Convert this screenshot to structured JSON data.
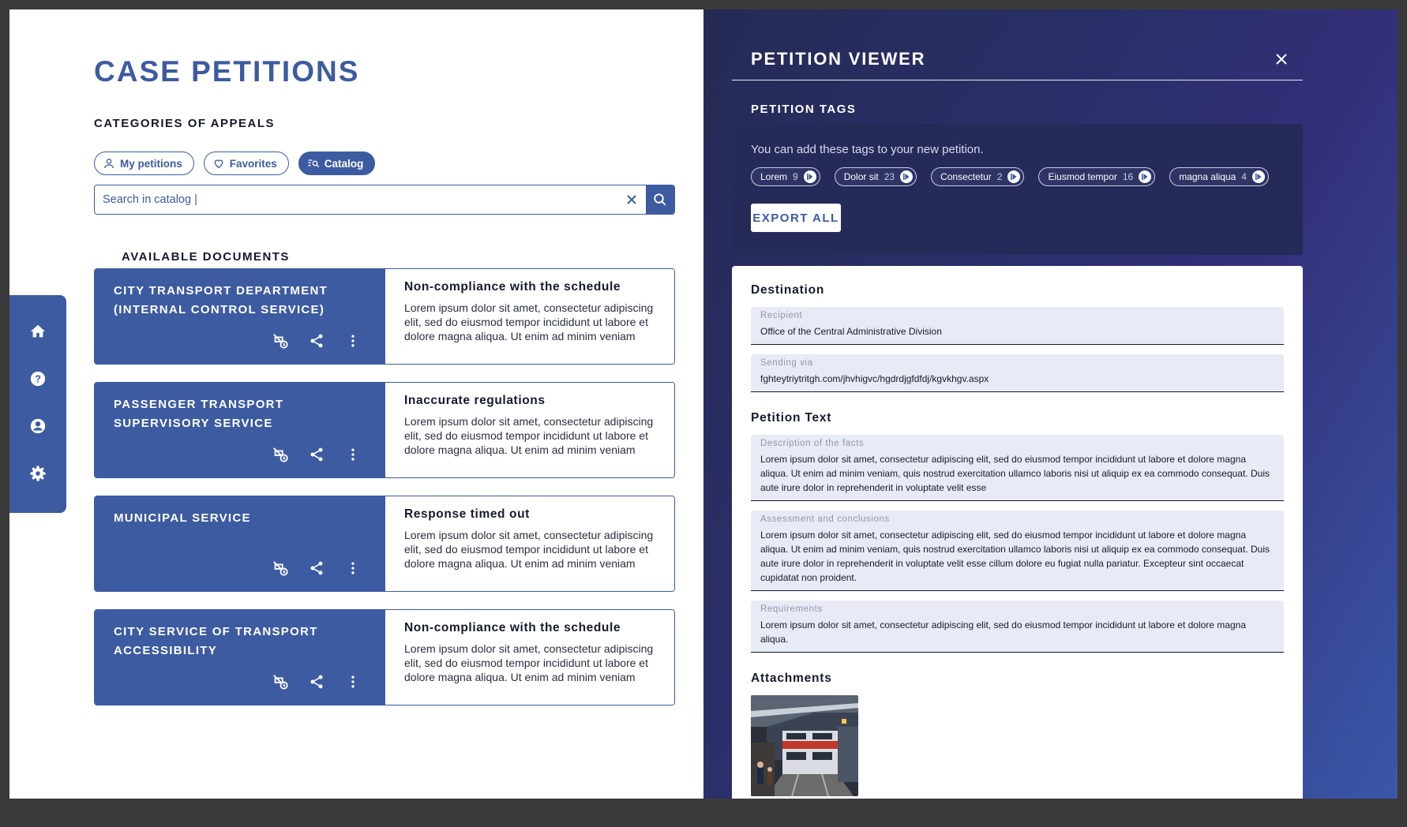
{
  "page_title": "CASE PETITIONS",
  "categories_title": "CATEGORIES OF APPEALS",
  "tabs": [
    {
      "label": "My petitions",
      "icon": "person-icon",
      "active": false
    },
    {
      "label": "Favorites",
      "icon": "heart-icon",
      "active": false
    },
    {
      "label": "Catalog",
      "icon": "catalog-search-icon",
      "active": true
    }
  ],
  "search": {
    "value": "Search in catalog |"
  },
  "side_nav": [
    {
      "icon": "home-icon"
    },
    {
      "icon": "help-icon"
    },
    {
      "icon": "account-icon"
    },
    {
      "icon": "settings-icon"
    }
  ],
  "documents_title": "AVAILABLE DOCUMENTS",
  "documents": [
    {
      "department": "CITY TRANSPORT DEPARTMENT (INTERNAL CONTROL SERVICE)",
      "title": "Non-compliance with the schedule",
      "text": "Lorem ipsum dolor sit amet, consectetur adipiscing elit, sed do eiusmod tempor incididunt ut labore et dolore magna aliqua. Ut enim ad minim veniam"
    },
    {
      "department": "PASSENGER TRANSPORT SUPERVISORY SERVICE",
      "title": "Inaccurate regulations",
      "text": "Lorem ipsum dolor sit amet, consectetur adipiscing elit, sed do eiusmod tempor incididunt ut labore et dolore magna aliqua. Ut enim ad minim veniam"
    },
    {
      "department": "MUNICIPAL SERVICE",
      "title": "Response timed out",
      "text": "Lorem ipsum dolor sit amet, consectetur adipiscing elit, sed do eiusmod tempor incididunt ut labore et dolore magna aliqua. Ut enim ad minim veniam"
    },
    {
      "department": "CITY SERVICE OF TRANSPORT ACCESSIBILITY",
      "title": "Non-compliance with the schedule",
      "text": "Lorem ipsum dolor sit amet, consectetur adipiscing elit, sed do eiusmod tempor incididunt ut labore et dolore magna aliqua. Ut enim ad minim veniam"
    }
  ],
  "viewer": {
    "title": "PETITION VIEWER",
    "tags_title": "PETITION TAGS",
    "tags_hint": "You can add these tags to your new petition.",
    "tags": [
      {
        "label": "Lorem",
        "count": "9"
      },
      {
        "label": "Dolor sit",
        "count": "23"
      },
      {
        "label": "Consectetur",
        "count": "2"
      },
      {
        "label": "Eiusmod tempor",
        "count": "16"
      },
      {
        "label": "magna aliqua",
        "count": "4"
      }
    ],
    "export_label": "EXPORT ALL",
    "destination_title": "Destination",
    "recipient_label": "Recipient",
    "recipient_value": "Office of the Central Administrative Division",
    "sending_label": "Sending via",
    "sending_value": "fghteytriytritgh.com/jhvhigvc/hgdrdjgfdfdj/kgvkhgv.aspx",
    "petition_text_title": "Petition Text",
    "facts_label": "Description of the facts",
    "facts_value": "Lorem ipsum dolor sit amet, consectetur adipiscing elit, sed do eiusmod tempor incididunt ut labore et dolore magna aliqua. Ut enim ad minim veniam, quis nostrud exercitation ullamco laboris nisi ut aliquip ex ea commodo consequat. Duis aute irure dolor in reprehenderit in voluptate velit esse",
    "assessment_label": "Assessment and conclusions",
    "assessment_value": "Lorem ipsum dolor sit amet, consectetur adipiscing elit, sed do eiusmod tempor incididunt ut labore et dolore magna aliqua. Ut enim ad minim veniam, quis nostrud exercitation ullamco laboris nisi ut aliquip ex ea commodo consequat. Duis aute irure dolor in reprehenderit in voluptate velit esse cillum dolore eu fugiat nulla pariatur. Excepteur sint occaecat cupidatat non proident.",
    "requirements_label": "Requirements",
    "requirements_value": "Lorem ipsum dolor sit amet, consectetur adipiscing elit, sed do eiusmod tempor incididunt ut labore et dolore magna aliqua.",
    "attachments_title": "Attachments"
  },
  "colors": {
    "primary": "#3d5ba1",
    "viewer_bg": "#2b2f6a",
    "tags_box": "#262a59",
    "field_bg": "#e8ebf6"
  }
}
